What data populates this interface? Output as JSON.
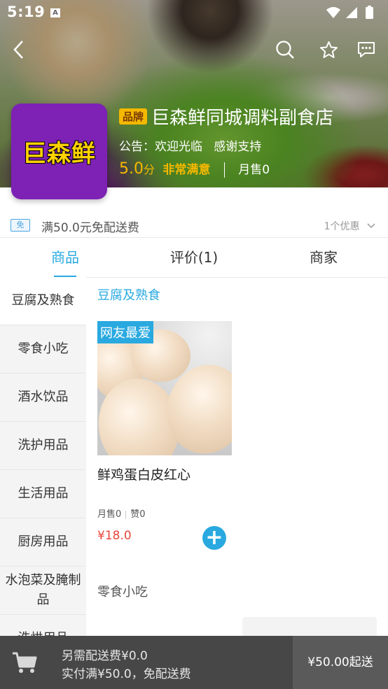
{
  "status": {
    "time": "5:19"
  },
  "shop": {
    "logo_text": "巨森鲜",
    "brand_badge": "品牌",
    "name": "巨森鲜同城调料副食店",
    "notice": "公告：欢迎光临   感谢支持",
    "score": "5.0",
    "score_unit": "分",
    "satisfaction": "非常满意",
    "monthly_sales": "月售0"
  },
  "promo": {
    "badge": "免",
    "text": "满50.0元免配送费",
    "count": "1个优惠"
  },
  "tabs": [
    {
      "label": "商品",
      "active": true
    },
    {
      "label": "评价(1)",
      "active": false
    },
    {
      "label": "商家",
      "active": false
    }
  ],
  "categories": [
    "豆腐及熟食",
    "零食小吃",
    "酒水饮品",
    "洗护用品",
    "生活用品",
    "厨房用品",
    "水泡菜及腌制品",
    "洗烘用品"
  ],
  "section1_title": "豆腐及熟食",
  "product": {
    "tag": "网友最爱",
    "name": "鲜鸡蛋白皮红心",
    "sales": "月售0",
    "likes": "赞0",
    "price": "¥18.0"
  },
  "section2_title": "零食小吃",
  "cart": {
    "line1": "另需配送费¥0.0",
    "line2": "实付满¥50.0，免配送费",
    "checkout": "¥50.00起送"
  },
  "colors": {
    "accent": "#29a9e0",
    "price": "#e8463c",
    "logo_bg": "#7d22b5",
    "logo_text": "#ffd200"
  }
}
